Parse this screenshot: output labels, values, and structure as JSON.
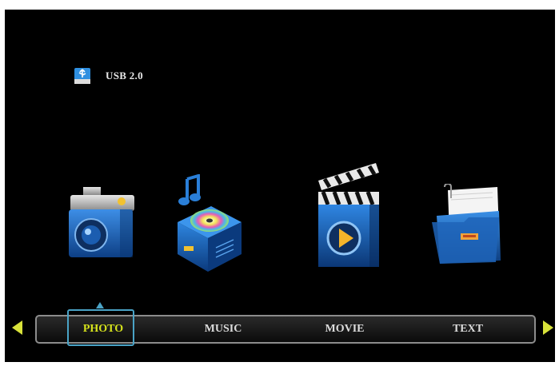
{
  "device": {
    "label": "USB 2.0",
    "icon": "usb-drive-icon"
  },
  "menu": {
    "items": [
      {
        "label": "PHOTO",
        "icon": "camera-icon",
        "selected": true
      },
      {
        "label": "MUSIC",
        "icon": "music-player-icon",
        "selected": false
      },
      {
        "label": "MOVIE",
        "icon": "clapperboard-icon",
        "selected": false
      },
      {
        "label": "TEXT",
        "icon": "document-folder-icon",
        "selected": false
      }
    ]
  },
  "colors": {
    "background": "#000000",
    "selected_text": "#d6e31c",
    "focus_border": "#4aa3c6",
    "arrow": "#d8e23a",
    "icon_blue": "#1e6fc4"
  }
}
